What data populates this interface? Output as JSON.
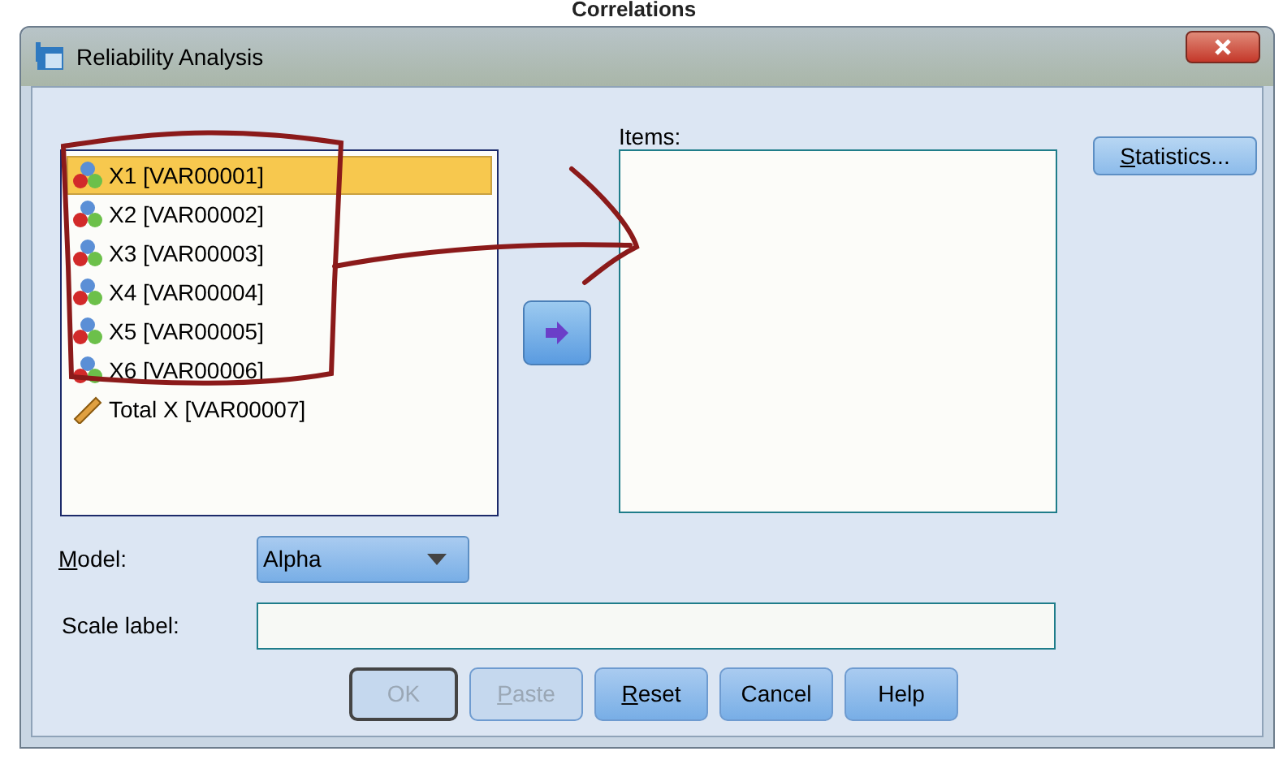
{
  "background_heading": "Correlations",
  "window": {
    "title": "Reliability Analysis"
  },
  "variables": [
    {
      "label": "X1 [VAR00001]",
      "kind": "nominal",
      "selected": true
    },
    {
      "label": "X2 [VAR00002]",
      "kind": "nominal",
      "selected": false
    },
    {
      "label": "X3 [VAR00003]",
      "kind": "nominal",
      "selected": false
    },
    {
      "label": "X4 [VAR00004]",
      "kind": "nominal",
      "selected": false
    },
    {
      "label": "X5 [VAR00005]",
      "kind": "nominal",
      "selected": false
    },
    {
      "label": "X6 [VAR00006]",
      "kind": "nominal",
      "selected": false
    },
    {
      "label": "Total X [VAR00007]",
      "kind": "scale",
      "selected": false
    }
  ],
  "items_label": "Items:",
  "statistics_button": "Statistics...",
  "model": {
    "label": "Model:",
    "value": "Alpha"
  },
  "scale_label": {
    "label": "Scale label:"
  },
  "buttons": [
    {
      "label": "OK",
      "disabled": true,
      "default": true,
      "access_key": false
    },
    {
      "label": "Paste",
      "disabled": true,
      "default": false,
      "access_key": true
    },
    {
      "label": "Reset",
      "disabled": false,
      "default": false,
      "access_key": true
    },
    {
      "label": "Cancel",
      "disabled": false,
      "default": false,
      "access_key": false
    },
    {
      "label": "Help",
      "disabled": false,
      "default": false,
      "access_key": false
    }
  ]
}
